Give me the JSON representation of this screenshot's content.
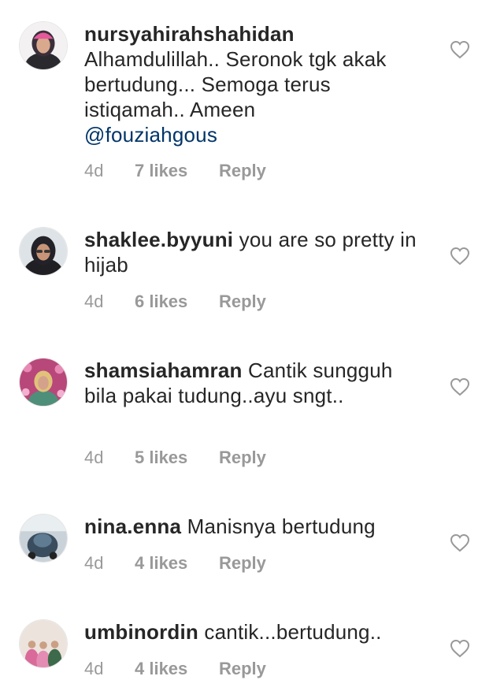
{
  "comments": [
    {
      "username": "nursyahirahshahidan",
      "text": "Alhamdulillah.. Seronok tgk akak bertudung... Semoga terus istiqamah.. Ameen",
      "mention": "@fouziahgous",
      "time": "4d",
      "likes": "7 likes",
      "reply": "Reply"
    },
    {
      "username": "shaklee.byyuni",
      "text": "you are so pretty in hijab",
      "time": "4d",
      "likes": "6 likes",
      "reply": "Reply"
    },
    {
      "username": "shamsiahamran",
      "text": "Cantik sungguh bila pakai tudung..ayu sngt..",
      "time": "4d",
      "likes": "5 likes",
      "reply": "Reply"
    },
    {
      "username": "nina.enna",
      "text": "Manisnya bertudung",
      "time": "4d",
      "likes": "4 likes",
      "reply": "Reply"
    },
    {
      "username": "umbinordin",
      "text": "cantik...bertudung..",
      "time": "4d",
      "likes": "4 likes",
      "reply": "Reply"
    }
  ],
  "icons": {
    "like": "heart-outline-icon"
  },
  "colors": {
    "text": "#262626",
    "meta": "#999999",
    "mention": "#003569"
  }
}
